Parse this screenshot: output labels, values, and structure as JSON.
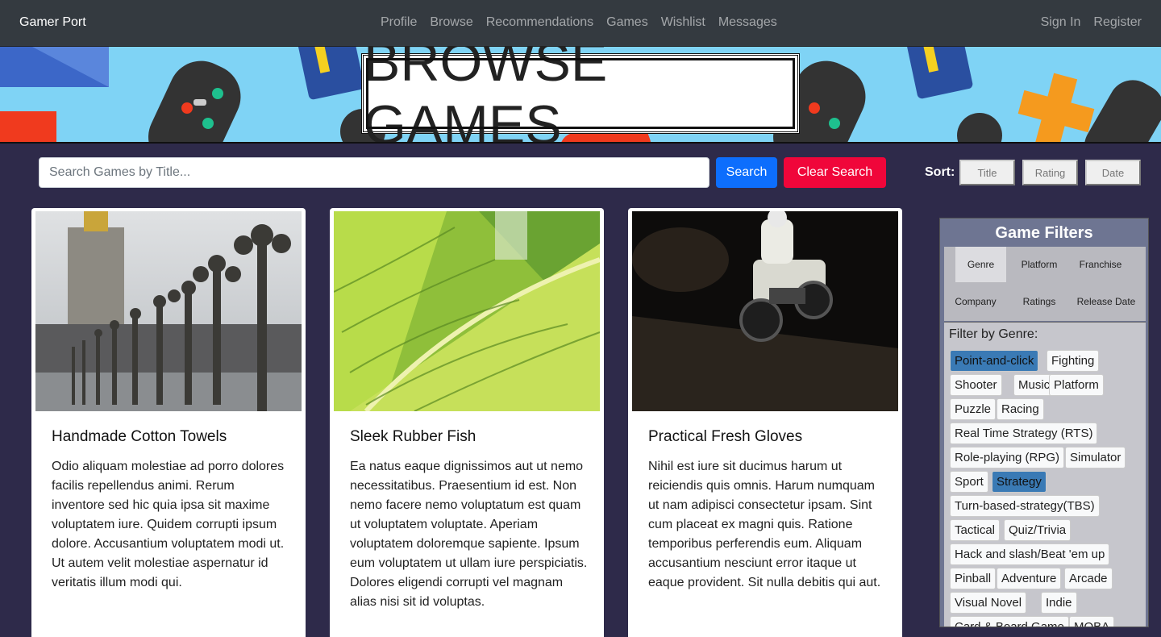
{
  "nav": {
    "brand": "Gamer Port",
    "links": [
      "Profile",
      "Browse",
      "Recommendations",
      "Games",
      "Wishlist",
      "Messages"
    ],
    "auth": [
      "Sign In",
      "Register"
    ]
  },
  "banner": {
    "title": "BROWSE GAMES"
  },
  "search": {
    "placeholder": "Search Games by Title...",
    "search_label": "Search",
    "clear_label": "Clear Search"
  },
  "sort": {
    "label": "Sort:",
    "options": [
      "Title",
      "Rating",
      "Date"
    ]
  },
  "cards": [
    {
      "title": "Handmade Cotton Towels",
      "text": "Odio aliquam molestiae ad porro dolores facilis repellendus animi. Rerum inventore sed hic quia ipsa sit maxime voluptatem iure. Quidem corrupti ipsum dolore. Accusantium voluptatem modi ut. Ut autem velit molestiae aspernatur id veritatis illum modi qui."
    },
    {
      "title": "Sleek Rubber Fish",
      "text": "Ea natus eaque dignissimos aut ut nemo necessitatibus. Praesentium id est. Non nemo facere nemo voluptatum est quam ut voluptatem voluptate. Aperiam voluptatem doloremque sapiente. Ipsum eum voluptatem ut ullam iure perspiciatis. Dolores eligendi corrupti vel magnam alias nisi sit id voluptas."
    },
    {
      "title": "Practical Fresh Gloves",
      "text": "Nihil est iure sit ducimus harum ut reiciendis quis omnis. Harum numquam ut nam adipisci consectetur ipsam. Sint cum placeat ex magni quis. Ratione temporibus perferendis eum. Aliquam accusantium nesciunt error itaque ut eaque provident. Sit nulla debitis qui aut."
    }
  ],
  "filters": {
    "title": "Game Filters",
    "tabs": [
      "Genre",
      "Platform",
      "Franchise",
      "Company",
      "Ratings",
      "Release Date"
    ],
    "active_tab": "Genre",
    "genre_label": "Filter by Genre:",
    "genres": [
      "Point-and-click",
      "Fighting",
      "Shooter",
      "Music",
      "Platform",
      "Puzzle",
      "Racing",
      "Real Time Strategy (RTS)",
      "Role-playing (RPG)",
      "Simulator",
      "Sport",
      "Strategy",
      "Turn-based-strategy(TBS)",
      "Tactical",
      "Quiz/Trivia",
      "Hack and slash/Beat 'em up",
      "Pinball",
      "Adventure",
      "Arcade",
      "Visual Novel",
      "Indie",
      "Card & Board Game",
      "MOBA"
    ],
    "selected_genres": [
      "Point-and-click",
      "Strategy"
    ]
  },
  "colors": {
    "navbar": "#343a40",
    "page_bg": "#2e2a4a",
    "banner_bg": "#7fd3f5",
    "search_btn": "#0d6efd",
    "clear_btn": "#f0063a",
    "chip_selected": "#3a7ab5"
  }
}
